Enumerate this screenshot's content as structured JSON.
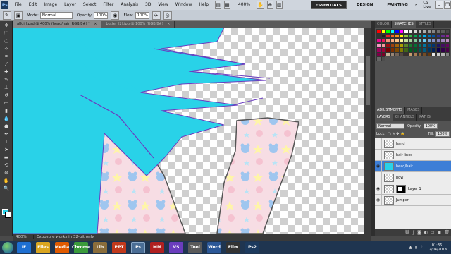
{
  "app": {
    "logo": "Ps"
  },
  "menu": [
    "File",
    "Edit",
    "Image",
    "Layer",
    "Select",
    "Filter",
    "Analysis",
    "3D",
    "View",
    "Window",
    "Help"
  ],
  "zoom_level": "400%",
  "workspaces": [
    "ESSENTIALS",
    "DESIGN",
    "PAINTING"
  ],
  "workspace_more": "»",
  "cs_live": "CS Live",
  "options_bar": {
    "mode_label": "Mode:",
    "mode_value": "Normal",
    "opacity_label": "Opacity:",
    "opacity_value": "100%",
    "flow_label": "Flow:",
    "flow_value": "100%"
  },
  "documents": [
    {
      "title": "alfgirl.psd @ 400% (head/hair, RGB/8#) *",
      "close": "×"
    },
    {
      "title": "butter (2).jpg @ 100% (RGB/8#)",
      "close": "×"
    }
  ],
  "status": {
    "zoom": "400%",
    "message": "Exposure works in 32-bit only"
  },
  "panels": {
    "color_tabs": [
      "COLOR",
      "SWATCHES",
      "STYLES"
    ],
    "adj_tabs": [
      "ADJUSTMENTS",
      "MASKS"
    ],
    "layers_tabs": [
      "LAYERS",
      "CHANNELS",
      "PATHS"
    ],
    "blend_mode": "Normal",
    "opacity_label": "Opacity:",
    "opacity_value": "100%",
    "lock_label": "Lock:",
    "fill_label": "Fill:",
    "fill_value": "100%"
  },
  "layers": [
    {
      "name": "hand",
      "visible": false,
      "selected": false
    },
    {
      "name": "hair lines",
      "visible": false,
      "selected": false
    },
    {
      "name": "head/hair",
      "visible": true,
      "selected": true
    },
    {
      "name": "bow",
      "visible": false,
      "selected": false
    },
    {
      "name": "Layer 1",
      "visible": true,
      "selected": false,
      "mask": true
    },
    {
      "name": "Jumper",
      "visible": true,
      "selected": false
    }
  ],
  "taskbar": {
    "apps": [
      "IE",
      "Files",
      "Media",
      "Chrome",
      "Lib",
      "PPT",
      "Ps",
      "MM",
      "VS",
      "Tool",
      "Word",
      "Film",
      "Ps2"
    ],
    "clock_time": "01:36",
    "clock_date": "12/04/2016"
  },
  "colors": {
    "hair": "#29d2e8",
    "hair_line": "#6a3cc0",
    "jumper": "#f7dde4",
    "layer_selected": "#3d7ed6"
  }
}
